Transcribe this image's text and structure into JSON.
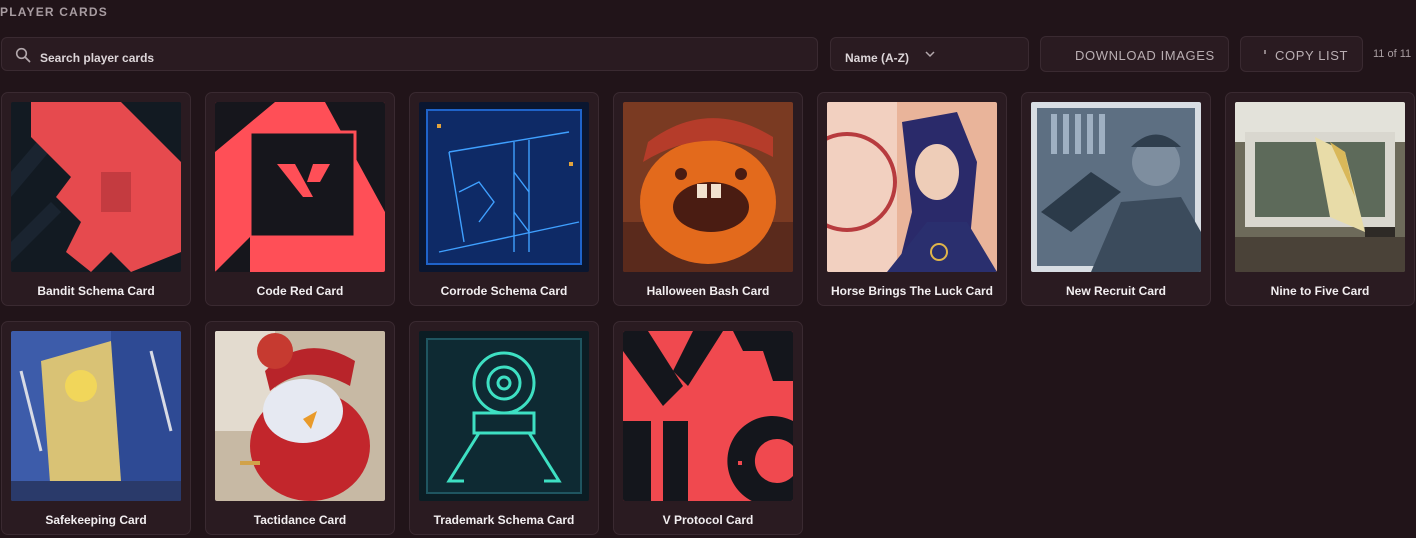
{
  "header": {
    "title": "PLAYER CARDS"
  },
  "search": {
    "placeholder": "Search player cards"
  },
  "sort": {
    "selected": "Name (A-Z)"
  },
  "toolbar": {
    "download_label": "DOWNLOAD IMAGES",
    "copy_label": "COPY LIST",
    "count": "11 of 11"
  },
  "cards": [
    {
      "name": "Bandit Schema Card"
    },
    {
      "name": "Code Red Card"
    },
    {
      "name": "Corrode Schema Card"
    },
    {
      "name": "Halloween Bash Card"
    },
    {
      "name": "Horse Brings The Luck Card"
    },
    {
      "name": "New Recruit Card"
    },
    {
      "name": "Nine to Five Card"
    },
    {
      "name": "Safekeeping Card"
    },
    {
      "name": "Tactidance Card"
    },
    {
      "name": "Trademark Schema Card"
    },
    {
      "name": "V Protocol Card"
    }
  ]
}
